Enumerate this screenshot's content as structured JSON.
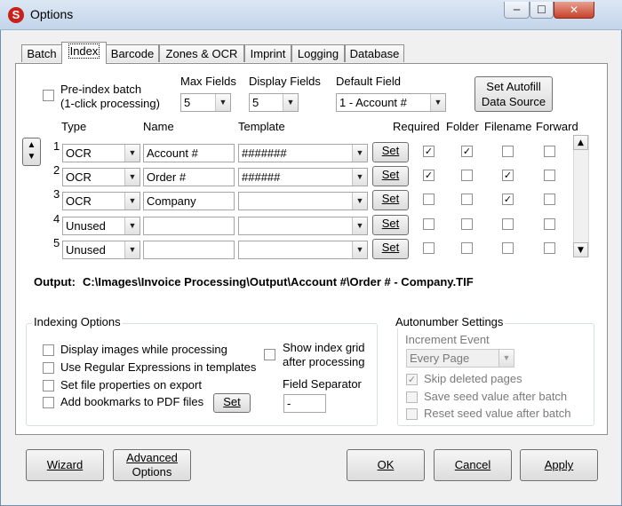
{
  "window": {
    "title": "Options",
    "app_icon": "S"
  },
  "tabs": [
    "Batch",
    "Index",
    "Barcode",
    "Zones & OCR",
    "Imprint",
    "Logging",
    "Database"
  ],
  "top": {
    "preindex_line1": "Pre-index batch",
    "preindex_line2": "(1-click processing)",
    "max_fields_label": "Max Fields",
    "max_fields_value": "5",
    "display_fields_label": "Display Fields",
    "display_fields_value": "5",
    "default_field_label": "Default Field",
    "default_field_value": "1 - Account #",
    "autofill_line1": "Set Autofill",
    "autofill_line2": "Data Source"
  },
  "columns": {
    "type": "Type",
    "name": "Name",
    "template": "Template",
    "required": "Required",
    "folder": "Folder",
    "filename": "Filename",
    "forward": "Forward"
  },
  "set_label": "Set",
  "fields": [
    {
      "num": "1",
      "type": "OCR",
      "name": "Account #",
      "template": "#######",
      "required": true,
      "folder": true,
      "filename": false,
      "forward": false
    },
    {
      "num": "2",
      "type": "OCR",
      "name": "Order #",
      "template": "######",
      "required": true,
      "folder": false,
      "filename": true,
      "forward": false
    },
    {
      "num": "3",
      "type": "OCR",
      "name": "Company",
      "template": "",
      "required": false,
      "folder": false,
      "filename": true,
      "forward": false
    },
    {
      "num": "4",
      "type": "Unused",
      "name": "",
      "template": "",
      "required": false,
      "folder": false,
      "filename": false,
      "forward": false
    },
    {
      "num": "5",
      "type": "Unused",
      "name": "",
      "template": "",
      "required": false,
      "folder": false,
      "filename": false,
      "forward": false
    }
  ],
  "output": {
    "label": "Output:",
    "path": "C:\\Images\\Invoice Processing\\Output\\Account #\\Order # - Company.TIF"
  },
  "indexing_options": {
    "title": "Indexing Options",
    "display_images": "Display images while processing",
    "regex": "Use Regular Expressions in templates",
    "file_props": "Set file properties on export",
    "bookmarks": "Add bookmarks to PDF files",
    "set_button": "Set",
    "show_grid_line1": "Show index grid",
    "show_grid_line2": "after processing",
    "separator_label": "Field Separator",
    "separator_value": "-"
  },
  "autonumber": {
    "title": "Autonumber Settings",
    "increment_label": "Increment Event",
    "increment_value": "Every Page",
    "skip_deleted": "Skip deleted pages",
    "save_seed": "Save seed value after batch",
    "reset_seed": "Reset seed value after batch"
  },
  "buttons": {
    "wizard": "Wizard",
    "advanced_line1": "Advanced",
    "advanced_line2": "Options",
    "ok": "OK",
    "cancel": "Cancel",
    "apply": "Apply"
  }
}
